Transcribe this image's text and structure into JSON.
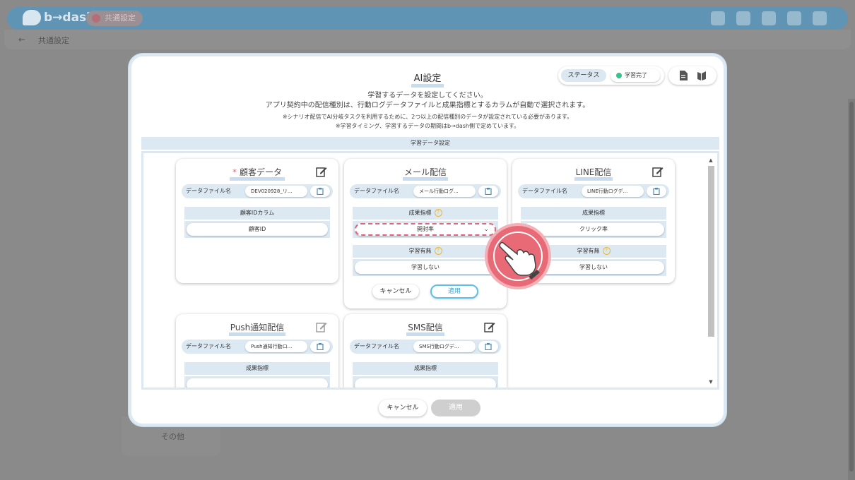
{
  "app": {
    "logo_text": "b→dash",
    "common_settings_pill": "共通設定",
    "breadcrumb": "共通設定",
    "sidebar_other": "その他"
  },
  "modal": {
    "title": "AI設定",
    "status": {
      "label": "ステータス",
      "value": "学習完了"
    },
    "desc_line1": "学習するデータを設定してください。",
    "desc_line2": "アプリ契約中の配信種別は、行動ログデータファイルと成果指標とするカラムが自動で選択されます。",
    "note_line1": "※シナリオ配信でAI分岐タスクを利用するために、2つ以上の配信種別のデータが設定されている必要があります。",
    "note_line2": "※学習タイミング、学習するデータの期間はb→dash側で定めています。",
    "section_title": "学習データ設定",
    "footer": {
      "cancel": "キャンセル",
      "apply": "適用"
    }
  },
  "cards": {
    "customer": {
      "required_mark": "*",
      "title": "顧客データ",
      "file_label": "データファイル名",
      "file_value": "DEV020928_リ...",
      "col_head": "顧客IDカラム",
      "col_value": "顧客ID"
    },
    "mail": {
      "title": "メール配信",
      "file_label": "データファイル名",
      "file_value": "メール行動ログ...",
      "metric_head": "成果指標",
      "metric_value": "開封率",
      "learn_head": "学習有無",
      "learn_value": "学習しない",
      "cancel": "キャンセル",
      "apply": "適用"
    },
    "line": {
      "title": "LINE配信",
      "file_label": "データファイル名",
      "file_value": "LINE行動ログデ...",
      "metric_head": "成果指標",
      "metric_value": "クリック率",
      "learn_head": "学習有無",
      "learn_value": "学習しない"
    },
    "push": {
      "title": "Push通知配信",
      "file_label": "データファイル名",
      "file_value": "Push通知行動ロ...",
      "metric_head": "成果指標"
    },
    "sms": {
      "title": "SMS配信",
      "file_label": "データファイル名",
      "file_value": "SMS行動ログデ...",
      "metric_head": "成果指標"
    }
  },
  "help_glyph": "?",
  "colors": {
    "accent": "#5dc1e6",
    "required": "#e2647a",
    "header_bg": "#dce9f3",
    "pointer": "#e96a77"
  }
}
